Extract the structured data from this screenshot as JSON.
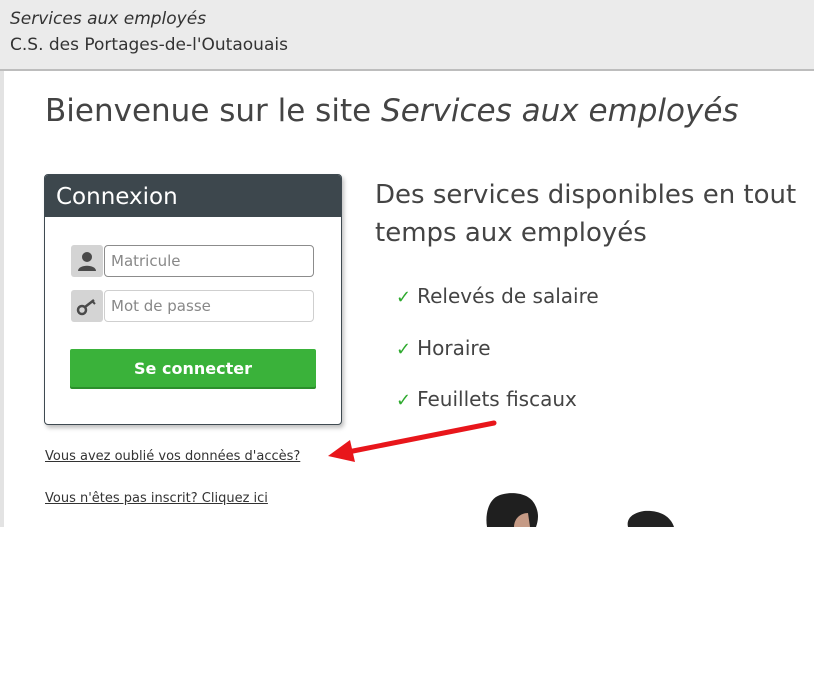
{
  "header": {
    "title": "Services aux employés",
    "org": "C.S. des Portages-de-l'Outaouais"
  },
  "welcome": {
    "prefix": "Bienvenue sur le site ",
    "site_name": "Services aux employés"
  },
  "login": {
    "title": "Connexion",
    "username_placeholder": "Matricule",
    "password_placeholder": "Mot de passe",
    "submit_label": "Se connecter",
    "username_icon": "user-icon",
    "password_icon": "key-icon"
  },
  "links": {
    "forgot": "Vous avez oublié vos données d'accès?",
    "register": "Vous n'êtes pas inscrit? Cliquez ici"
  },
  "services": {
    "title": "Des services disponibles en tout temps aux employés",
    "items": [
      "Relevés de salaire",
      "Horaire",
      "Feuillets fiscaux"
    ]
  },
  "colors": {
    "header_bg": "#ebebeb",
    "card_header": "#3d474d",
    "button_green": "#3ab23a",
    "check_green": "#2eaa2e",
    "arrow_red": "#e8161b"
  }
}
